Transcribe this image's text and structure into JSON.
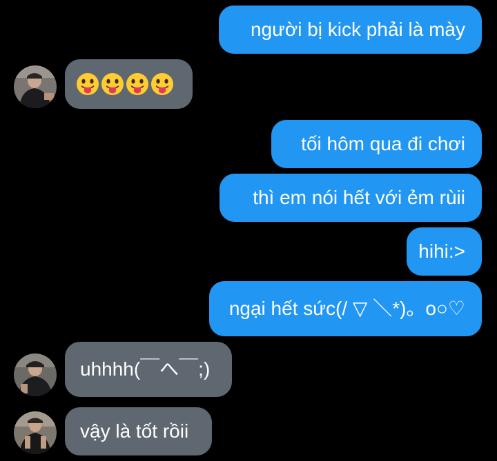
{
  "conversation": {
    "messages": [
      {
        "from": "me",
        "text": "người bị kick phải là mày"
      },
      {
        "from": "them",
        "emoji": [
          "face-with-tongue-emoji",
          "face-with-tongue-emoji",
          "face-with-tongue-emoji",
          "face-with-tongue-emoji"
        ]
      },
      {
        "from": "me",
        "text": "tối hôm qua đi chơi"
      },
      {
        "from": "me",
        "text": "thì em nói hết với ẻm rùii"
      },
      {
        "from": "me",
        "text": "hihi:>"
      },
      {
        "from": "me",
        "text": "ngại hết sức(/ ▽ ＼*)。o○♡"
      },
      {
        "from": "them",
        "text": "uhhhh(￣へ￣;)"
      },
      {
        "from": "them",
        "text": "vậy là tốt rồii"
      }
    ]
  },
  "colors": {
    "background": "#000000",
    "outgoing_bubble": "#2196f3",
    "incoming_bubble": "#5f6871",
    "text": "#ffffff"
  }
}
